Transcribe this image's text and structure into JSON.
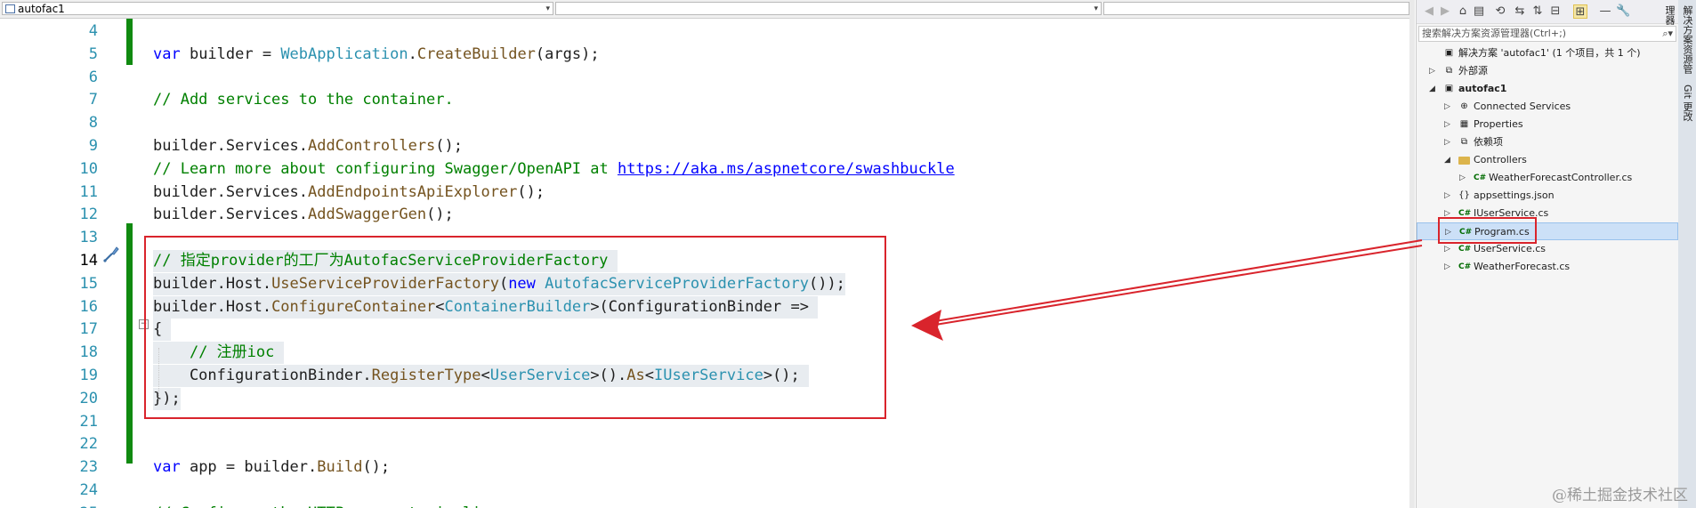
{
  "editor": {
    "project_combo": "autofac1",
    "lines": [
      {
        "num": "4",
        "tokens": []
      },
      {
        "num": "5",
        "tokens": [
          {
            "t": "var",
            "c": "kw"
          },
          {
            "t": " builder = "
          },
          {
            "t": "WebApplication",
            "c": "ty"
          },
          {
            "t": "."
          },
          {
            "t": "CreateBuilder",
            "c": "mt"
          },
          {
            "t": "(args);"
          }
        ]
      },
      {
        "num": "6",
        "tokens": []
      },
      {
        "num": "7",
        "tokens": [
          {
            "t": "// Add services to the container.",
            "c": "cm"
          }
        ]
      },
      {
        "num": "8",
        "tokens": []
      },
      {
        "num": "9",
        "tokens": [
          {
            "t": "builder.Services."
          },
          {
            "t": "AddControllers",
            "c": "mt"
          },
          {
            "t": "();"
          }
        ]
      },
      {
        "num": "10",
        "tokens": [
          {
            "t": "// Learn more about configuring Swagger/OpenAPI at ",
            "c": "cm"
          },
          {
            "t": "https://aka.ms/aspnetcore/swashbuckle",
            "c": "ln-link"
          }
        ]
      },
      {
        "num": "11",
        "tokens": [
          {
            "t": "builder.Services."
          },
          {
            "t": "AddEndpointsApiExplorer",
            "c": "mt"
          },
          {
            "t": "();"
          }
        ]
      },
      {
        "num": "12",
        "tokens": [
          {
            "t": "builder.Services."
          },
          {
            "t": "AddSwaggerGen",
            "c": "mt"
          },
          {
            "t": "();"
          }
        ]
      },
      {
        "num": "13",
        "tokens": []
      },
      {
        "num": "14",
        "tokens": [
          {
            "t": "// 指定provider的工厂为AutofacServiceProviderFactory ",
            "c": "cm"
          }
        ],
        "hl": true,
        "current": true
      },
      {
        "num": "15",
        "tokens": [
          {
            "t": "builder.Host."
          },
          {
            "t": "UseServiceProviderFactory",
            "c": "mt"
          },
          {
            "t": "("
          },
          {
            "t": "new",
            "c": "kw"
          },
          {
            "t": " "
          },
          {
            "t": "AutofacServiceProviderFactory",
            "c": "ty"
          },
          {
            "t": "());"
          }
        ],
        "hl": true
      },
      {
        "num": "16",
        "tokens": [
          {
            "t": "builder.Host."
          },
          {
            "t": "ConfigureContainer",
            "c": "mt"
          },
          {
            "t": "<"
          },
          {
            "t": "ContainerBuilder",
            "c": "ty"
          },
          {
            "t": ">(ConfigurationBinder => "
          }
        ],
        "hl": true
      },
      {
        "num": "17",
        "tokens": [
          {
            "t": "{ "
          }
        ],
        "hl": true
      },
      {
        "num": "18",
        "tokens": [
          {
            "t": "    "
          },
          {
            "t": "// 注册ioc ",
            "c": "cm"
          }
        ],
        "hl": true
      },
      {
        "num": "19",
        "tokens": [
          {
            "t": "    ConfigurationBinder."
          },
          {
            "t": "RegisterType",
            "c": "mt"
          },
          {
            "t": "<"
          },
          {
            "t": "UserService",
            "c": "ty"
          },
          {
            "t": ">()."
          },
          {
            "t": "As",
            "c": "mt"
          },
          {
            "t": "<"
          },
          {
            "t": "IUserService",
            "c": "ty"
          },
          {
            "t": ">(); "
          }
        ],
        "hl": true
      },
      {
        "num": "20",
        "tokens": [
          {
            "t": "});"
          }
        ],
        "hl": true
      },
      {
        "num": "21",
        "tokens": []
      },
      {
        "num": "22",
        "tokens": []
      },
      {
        "num": "23",
        "tokens": [
          {
            "t": "var",
            "c": "kw"
          },
          {
            "t": " app = builder."
          },
          {
            "t": "Build",
            "c": "mt"
          },
          {
            "t": "();"
          }
        ]
      },
      {
        "num": "24",
        "tokens": []
      },
      {
        "num": "25",
        "tokens": [
          {
            "t": "// Configure the HTTP request pipeline.",
            "c": "cm"
          }
        ]
      }
    ]
  },
  "solution_explorer": {
    "search_placeholder": "搜索解决方案资源管理器(Ctrl+;)",
    "side_tabs": [
      "解决方案资源管理器",
      "Git 更改"
    ],
    "toolbar_icons": [
      "back-icon",
      "forward-icon",
      "home-icon",
      "switch-views-icon",
      "history-icon",
      "pending-changes-icon",
      "sync-icon",
      "collapse-all-icon",
      "show-all-files-icon",
      "show-active-doc-icon",
      "properties-icon"
    ],
    "items": [
      {
        "label": "解决方案 'autofac1' (1 个项目，共 1 个)",
        "icon": "solution-icon",
        "level": 0
      },
      {
        "label": "外部源",
        "icon": "external-sources-icon",
        "level": 0,
        "toggle": "▷"
      },
      {
        "label": "autofac1",
        "icon": "project-icon",
        "level": 0,
        "toggle": "◢",
        "bold": true
      },
      {
        "label": "Connected Services",
        "icon": "connected-services-icon",
        "level": 1,
        "toggle": "▷"
      },
      {
        "label": "Properties",
        "icon": "properties-folder-icon",
        "level": 1,
        "toggle": "▷"
      },
      {
        "label": "依赖项",
        "icon": "dependencies-icon",
        "level": 1,
        "toggle": "▷"
      },
      {
        "label": "Controllers",
        "icon": "folder-icon",
        "level": 1,
        "toggle": "◢"
      },
      {
        "label": "WeatherForecastController.cs",
        "icon": "csharp-file-icon",
        "level": 2,
        "toggle": "▷"
      },
      {
        "label": "appsettings.json",
        "icon": "json-file-icon",
        "level": 1,
        "toggle": "▷"
      },
      {
        "label": "IUserService.cs",
        "icon": "csharp-file-icon",
        "level": 1,
        "toggle": "▷"
      },
      {
        "label": "Program.cs",
        "icon": "csharp-file-icon",
        "level": 1,
        "toggle": "▷",
        "selected": true
      },
      {
        "label": "UserService.cs",
        "icon": "csharp-file-icon",
        "level": 1,
        "toggle": "▷"
      },
      {
        "label": "WeatherForecast.cs",
        "icon": "csharp-file-icon",
        "level": 1,
        "toggle": "▷"
      }
    ]
  },
  "watermark": "@稀土掘金技术社区"
}
